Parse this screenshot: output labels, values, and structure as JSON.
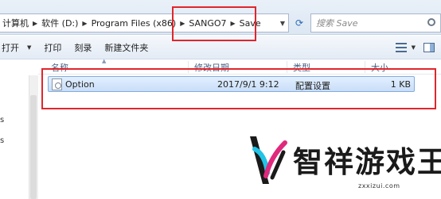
{
  "address_bar": {
    "breadcrumbs": [
      {
        "label": "计算机"
      },
      {
        "label": "软件 (D:)"
      },
      {
        "label": "Program Files (x86)"
      },
      {
        "label": "SANGO7"
      },
      {
        "label": "Save"
      }
    ],
    "search_placeholder": "搜索 Save"
  },
  "toolbar": {
    "open_label": "打开",
    "print_label": "打印",
    "burn_label": "刻录",
    "new_folder_label": "新建文件夹"
  },
  "columns": {
    "name": "名称",
    "date_modified": "修改日期",
    "type": "类型",
    "size": "大小"
  },
  "files": [
    {
      "name": "Option",
      "date_modified": "2017/9/1 9:12",
      "type": "配置设置",
      "size": "1 KB"
    }
  ],
  "left_nav": {
    "glyphs": [
      "s",
      "s"
    ]
  },
  "watermark": {
    "title": "智祥游戏王",
    "url": "zxxizui.com",
    "colors": {
      "cyan": "#22c3e6",
      "magenta": "#e0287d",
      "dark": "#1a1a1a"
    }
  },
  "highlight_color": "#e0262c"
}
